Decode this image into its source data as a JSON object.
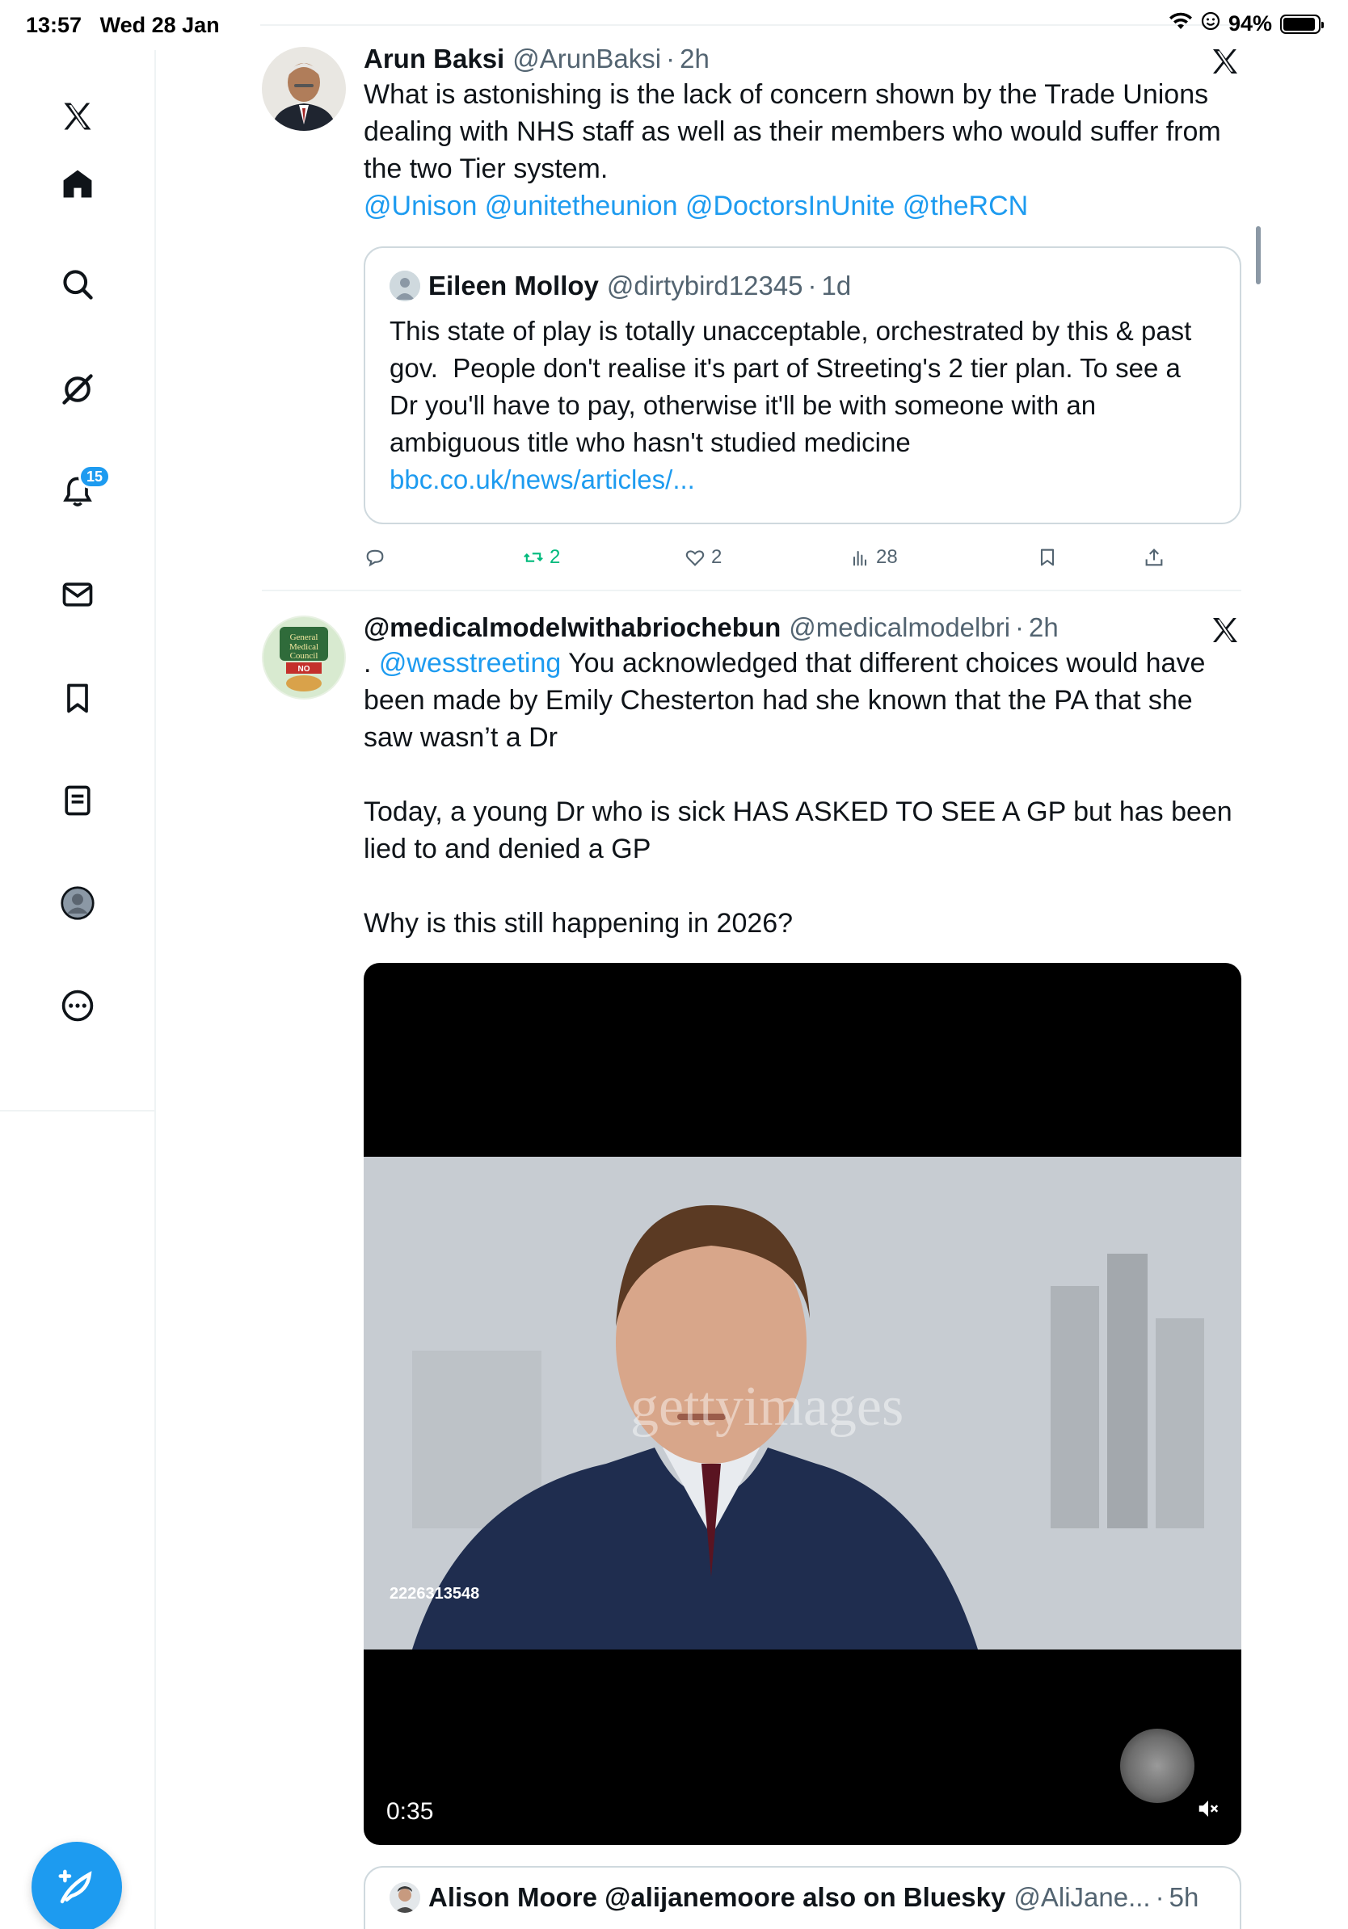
{
  "status_bar": {
    "time": "13:57",
    "date": "Wed 28 Jan",
    "battery": "94%",
    "battery_level": 0.94
  },
  "sidebar": {
    "items": [
      {
        "name": "x-logo-icon"
      },
      {
        "name": "home-icon"
      },
      {
        "name": "search-icon"
      },
      {
        "name": "grok-icon"
      },
      {
        "name": "notifications-icon",
        "badge": "15"
      },
      {
        "name": "messages-icon"
      },
      {
        "name": "bookmarks-icon"
      },
      {
        "name": "lists-icon"
      },
      {
        "name": "profile-icon"
      },
      {
        "name": "more-icon"
      }
    ],
    "compose_icon": "compose-feather-icon"
  },
  "tweets": [
    {
      "name": "Arun Baksi",
      "handle": "@ArunBaksi",
      "time": "2h",
      "text": "What is astonishing is the lack of concern shown by the Trade Unions dealing with NHS staff as well as their members who would suffer from the two Tier system.",
      "mentions": "@Unison @unitetheunion @DoctorsInUnite @theRCN",
      "quote": {
        "name": "Eileen Molloy",
        "handle": "@dirtybird12345",
        "time": "1d",
        "text": "This state of play is totally unacceptable, orchestrated by this & past gov.  People don't realise it's part of Streeting's 2 tier plan. To see a Dr you'll have to pay, otherwise it'll be with someone with an ambiguous title who hasn't studied medicine",
        "link": "bbc.co.uk/news/articles/..."
      },
      "actions": {
        "reply": "",
        "retweet": "2",
        "like": "2",
        "views": "28"
      }
    },
    {
      "name": "@medicalmodelwithabriochebun",
      "handle": "@medicalmodelbri",
      "time": "2h",
      "text_prefix": ". ",
      "mention": "@wesstreeting",
      "text_1": " You acknowledged that different choices would have been made by Emily Chesterton had she known that the PA that she saw wasn’t a Dr",
      "text_2": "Today, a young Dr who is sick HAS ASKED TO SEE A GP but has been lied to and denied a GP",
      "text_3": "Why is this still happening in 2026?",
      "video": {
        "duration": "0:35",
        "image_id": "2226313548",
        "watermark": "gettyimages"
      }
    }
  ],
  "bottom_quote": {
    "name": "Alison Moore @alijanemoore also on Bluesky",
    "handle": "@AliJane...",
    "time": "5h"
  }
}
